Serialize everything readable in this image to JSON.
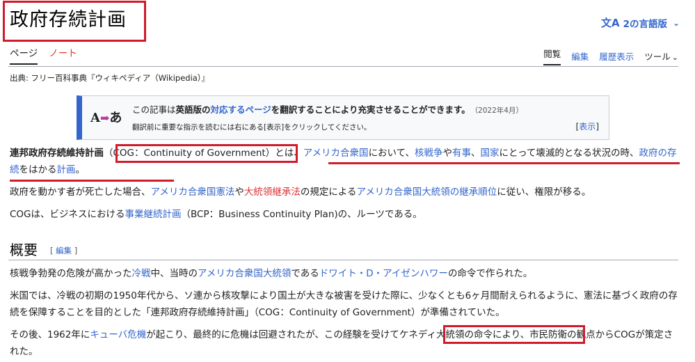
{
  "page": {
    "title": "政府存続計画",
    "language_button": "2の言語版",
    "language_icon": "translate-icon"
  },
  "tabs": {
    "left": [
      "ページ",
      "ノート"
    ],
    "right": [
      "閲覧",
      "編集",
      "履歴表示",
      "ツール"
    ]
  },
  "source": "出典: フリー百科事典『ウィキペディア（Wikipedia）』",
  "notice": {
    "logo_a": "A",
    "logo_arrow": "➡",
    "logo_ja": "あ",
    "t1": "この記事は",
    "t2": "英語版の",
    "t3": "対応するページ",
    "t4": "を翻訳することにより充実させることができます。",
    "date": "（2022年4月）",
    "sub": "翻訳前に重要な指示を読むには右にある[表示]をクリックしてください。",
    "show_open": "[",
    "show": "表示",
    "show_close": "]"
  },
  "p1": {
    "term": "連邦政府存続維持計画",
    "abbr": "（COG：Continuity of Government）",
    "s1": "とは、",
    "l1": "アメリカ合衆国",
    "s2": "において、",
    "l2": "核戦争",
    "s3": "や",
    "l3": "有事",
    "s4": "、",
    "l4": "国家",
    "s5": "にとって壊滅的となる状況の時、",
    "l5": "政府の存続",
    "s6": "をはかる",
    "l6": "計画",
    "s7": "。"
  },
  "p2": {
    "s1": "政府を動かす者が死亡した場合、",
    "l1": "アメリカ合衆国憲法",
    "s2": "や",
    "r1": "大統領継承法",
    "s3": "の規定による",
    "l2": "アメリカ合衆国大統領の継承順位",
    "s4": "に従い、権限が移る。"
  },
  "p3": {
    "s1": "COGは、ビジネスにおける",
    "l1": "事業継続計画",
    "s2": "（BCP：Business Continuity Plan)の、ルーツである。"
  },
  "section": {
    "heading": "概要",
    "edit_open": "[ ",
    "edit": "編集",
    "edit_close": " ]"
  },
  "p4": {
    "s1": "核戦争勃発の危険が高かった",
    "l1": "冷戦",
    "s2": "中、当時の",
    "l2": "アメリカ合衆国大統領",
    "s3": "である",
    "l3": "ドワイト・D・アイゼンハワー",
    "s4": "の命令で作られた。"
  },
  "p5": {
    "text": "米国では、冷戦の初期の1950年代から、ソ連から核攻撃により国土が大きな被害を受けた際に、少なくとも6ヶ月間耐えられるように、憲法に基づく政府の存続を保障することを目的とした「連邦政府存続維持計画」（COG：Continuity of Government）が準備されていた。"
  },
  "p6": {
    "s1": "その後、1962年に",
    "l1": "キューバ危機",
    "s2": "が起こり、最終的に危機は回避されたが、この経験を受けて",
    "s3": "ケネディ大統領の命令により",
    "s4": "、市民防衛の観点からCOGが策定された。"
  },
  "colors": {
    "link": "#3366cc",
    "redlink": "#dd3333",
    "highlight": "#d11a2a"
  }
}
